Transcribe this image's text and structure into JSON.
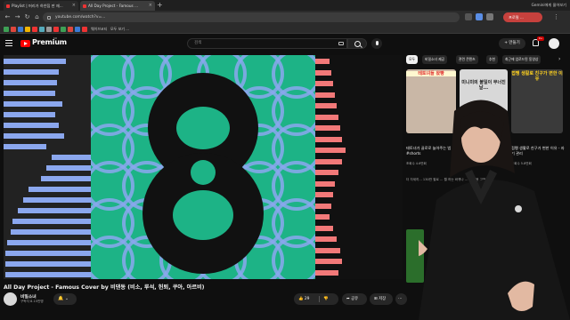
{
  "browser": {
    "tabs": [
      {
        "title": "Playlist | 머리가 하얀집 딴 재..."
      },
      {
        "title": "All Day Project - Famous ..."
      }
    ],
    "new_tab": "+",
    "tab_right": "Gemini에게 물어보기",
    "url": "youtube.com/watch?v=...",
    "profile": "프로필 ...",
    "bookmarks": [
      "",
      "",
      "",
      "",
      "",
      "",
      "",
      "",
      "",
      "",
      "",
      "",
      "웨이브코티",
      "",
      "모두 보기 ..."
    ]
  },
  "header": {
    "logo_text": "Premium",
    "region": "KR",
    "search_placeholder": "검색",
    "create_label": "+ 만들기",
    "notification_count": "9+"
  },
  "video": {
    "title": "All Day Project - Famous Cover by 비댄동 (비소, 루석, 헌퇴, 쿠아, 아르비)",
    "channel_name": "비밀소녀",
    "channel_subs": "구독자 8.15만명",
    "subscribe_label": "🔔 ⌄",
    "likes": "29",
    "share_label": "공유",
    "save_label": "저장",
    "more_label": "⋯"
  },
  "sidebar": {
    "chips": [
      "모두",
      "비밀소녀 제공",
      "관련 콘텐츠",
      "추천",
      "최근에 업로드된 동영상"
    ],
    "recs": [
      {
        "thumb_caption": "테토녀들 왔빵",
        "title": "테토녀가 골로로 놀아주는 법 #shorts",
        "meta": "조회수 4.6만회"
      },
      {
        "thumb_caption": "미니미의 불일이 무너진 날...",
        "title": "미니미의 불일이 무너진 날...",
        "meta": "조회수 15만회"
      },
      {
        "thumb_caption": "접쨍 생활로 친구가 변한 이유",
        "title": "접쨍 생활로 친구가 변한 이유 - 자기 관리",
        "meta": "조회수 5.8만회"
      }
    ],
    "side_text": "더 자세히... 130만 팔로 ... 뭘 하는 바뀌나 ... 수 있음 고전한 ..."
  },
  "colors": {
    "bg": "#0f0f0f",
    "art_green": "#1db386",
    "art_black": "#111111",
    "art_blue": "#8ba7ee",
    "art_pink": "#f27979",
    "youtube_red": "#ff0000"
  }
}
